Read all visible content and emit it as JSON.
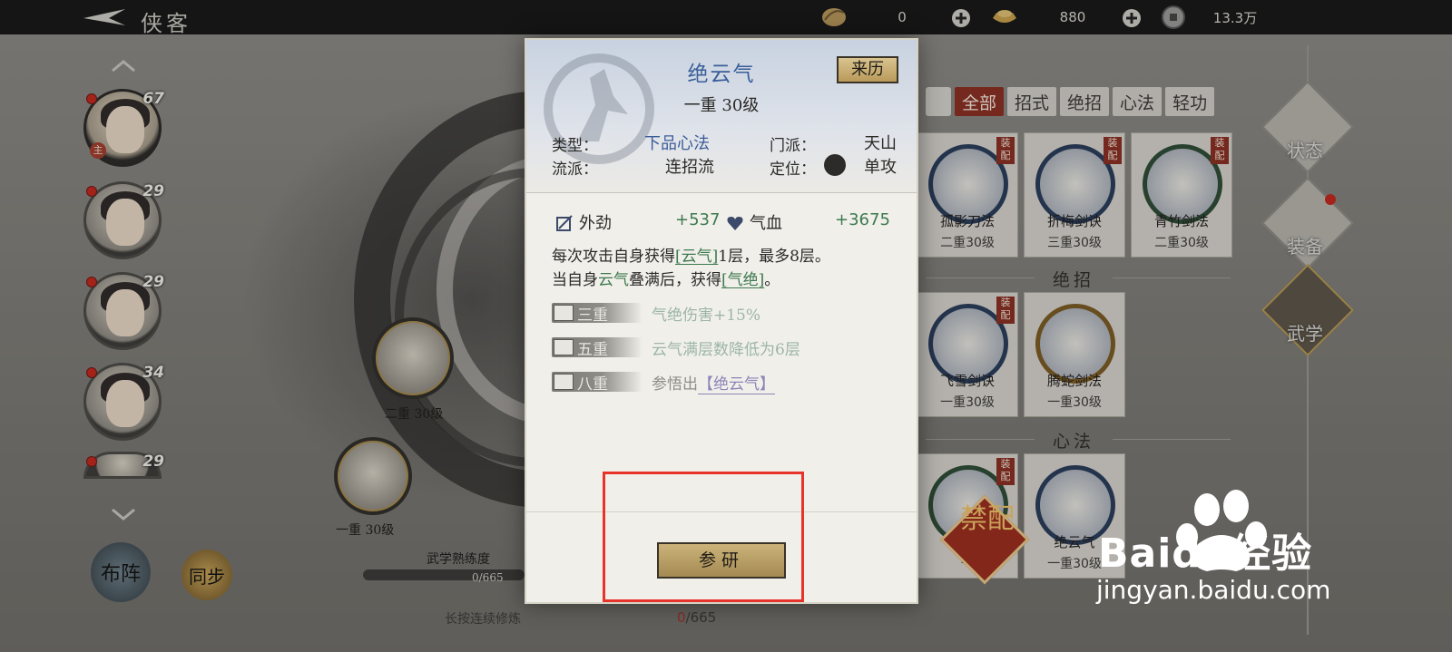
{
  "header": {
    "title": "侠客",
    "currencies": [
      {
        "icon": "leaf-token-icon",
        "value": "0"
      },
      {
        "icon": "gold-ingot-icon",
        "value": "880"
      },
      {
        "icon": "coin-icon",
        "value": "13.3万"
      }
    ]
  },
  "roster": {
    "heroes": [
      {
        "level": "67",
        "tag": "主"
      },
      {
        "level": "29",
        "tag": ""
      },
      {
        "level": "29",
        "tag": ""
      },
      {
        "level": "34",
        "tag": ""
      },
      {
        "level": "29",
        "tag": ""
      }
    ],
    "formation_label": "布阵",
    "sync_label": "同步"
  },
  "left_area": {
    "skill_levels": [
      "二重 30级",
      "一重 30级"
    ],
    "mastery_label": "武学熟练度",
    "mastery_value": "0/665",
    "hold_hint": "长按连续修炼",
    "item_count_have": "0",
    "item_count_total": "/665"
  },
  "filters": [
    "全部",
    "招式",
    "绝招",
    "心法",
    "轻功"
  ],
  "grid": {
    "row1": [
      {
        "name": "孤影刀法",
        "level": "二重30级",
        "badge": "装配"
      },
      {
        "name": "折梅剑诀",
        "level": "三重30级",
        "badge": "装配"
      },
      {
        "name": "青竹剑法",
        "level": "二重30级",
        "badge": "装配"
      }
    ],
    "section_ultimate": "绝招",
    "row2": [
      {
        "name": "飞雪剑诀",
        "level": "一重30级",
        "badge": "装配"
      },
      {
        "name": "腾蛇剑法",
        "level": "一重30级",
        "badge": ""
      }
    ],
    "section_inner": "心法",
    "row3": [
      {
        "name": "",
        "level": "一",
        "badge": "装配"
      },
      {
        "name": "绝云气",
        "level": "一重30级",
        "badge": ""
      }
    ]
  },
  "side_nav": [
    "状态",
    "装备",
    "武学"
  ],
  "forbid_stamp": "禁配",
  "watermark": {
    "brand": "Baidu经验",
    "url": "jingyan.baidu.com"
  },
  "popup": {
    "name": "绝云气",
    "level": "一重 30级",
    "origin_label": "来历",
    "type_label": "类型：",
    "type_value": "下品心法",
    "sect_label": "门派：",
    "sect_value": "天山",
    "style_label": "流派：",
    "style_value": "连招流",
    "role_label": "定位：",
    "role_value": "单攻",
    "stats": [
      {
        "label": "外劲",
        "value": "+537"
      },
      {
        "label": "气血",
        "value": "+3675"
      }
    ],
    "desc_line1_a": "每次攻击自身获得",
    "desc_line1_kw": "[云气]",
    "desc_line1_b": "1层，最多8层。",
    "desc_line2_a": "当自身",
    "desc_line2_kw": "云气",
    "desc_line2_b": "叠满后，获得",
    "desc_line2_kw2": "[气绝]",
    "desc_line2_c": "。",
    "tiers": [
      {
        "name": "三重",
        "effect": "气绝伤害+15%"
      },
      {
        "name": "五重",
        "effect": "云气满层数降低为6层"
      },
      {
        "name": "八重",
        "effect_pre": "参悟出",
        "effect_link": "【绝云气】"
      }
    ],
    "research_label": "参研"
  }
}
